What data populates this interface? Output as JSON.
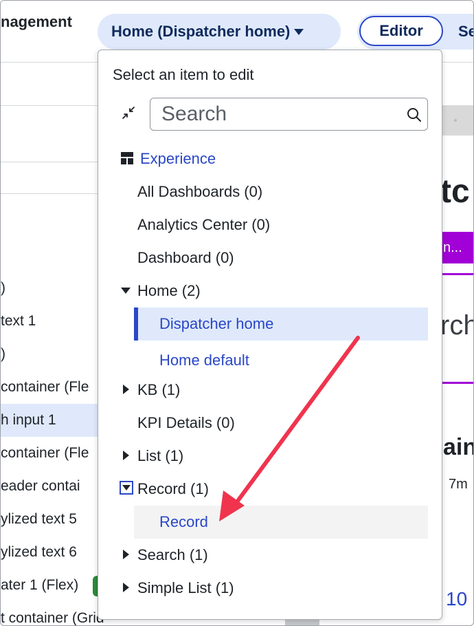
{
  "topbar": {
    "app_title": "nagement",
    "page_picker_label": "Home (Dispatcher home)",
    "editor_label": "Editor",
    "settings_label": "Se"
  },
  "left_panel": {
    "rows": [
      ")",
      "text 1",
      ")",
      "container (Fle",
      "h input 1",
      "container (Fle",
      "eader contai",
      "ylized text 5",
      "ylized text 6",
      "ater 1 (Flex)",
      "t container (Grid)"
    ]
  },
  "canvas": {
    "heading_fragment": "tc",
    "button_fragment": "n...",
    "search_fragment": "rch",
    "main_fragment": "ain",
    "time_fragment": "7m",
    "link_fragment": "10"
  },
  "dropdown": {
    "title": "Select an item to edit",
    "search_placeholder": "Search",
    "section_label": "Experience",
    "items": [
      {
        "label": "All Dashboards (0)"
      },
      {
        "label": "Analytics Center (0)"
      },
      {
        "label": "Dashboard (0)"
      },
      {
        "label": "Home (2)"
      },
      {
        "label": "Dispatcher home"
      },
      {
        "label": "Home default"
      },
      {
        "label": "KB (1)"
      },
      {
        "label": "KPI Details (0)"
      },
      {
        "label": "List (1)"
      },
      {
        "label": "Record (1)"
      },
      {
        "label": "Record"
      },
      {
        "label": "Search (1)"
      },
      {
        "label": "Simple List (1)"
      }
    ]
  },
  "colors": {
    "accent": "#2a47c7",
    "picker_bg": "#dfe9fb",
    "annotation_arrow": "#f0344e",
    "purple": "#a100d6"
  }
}
